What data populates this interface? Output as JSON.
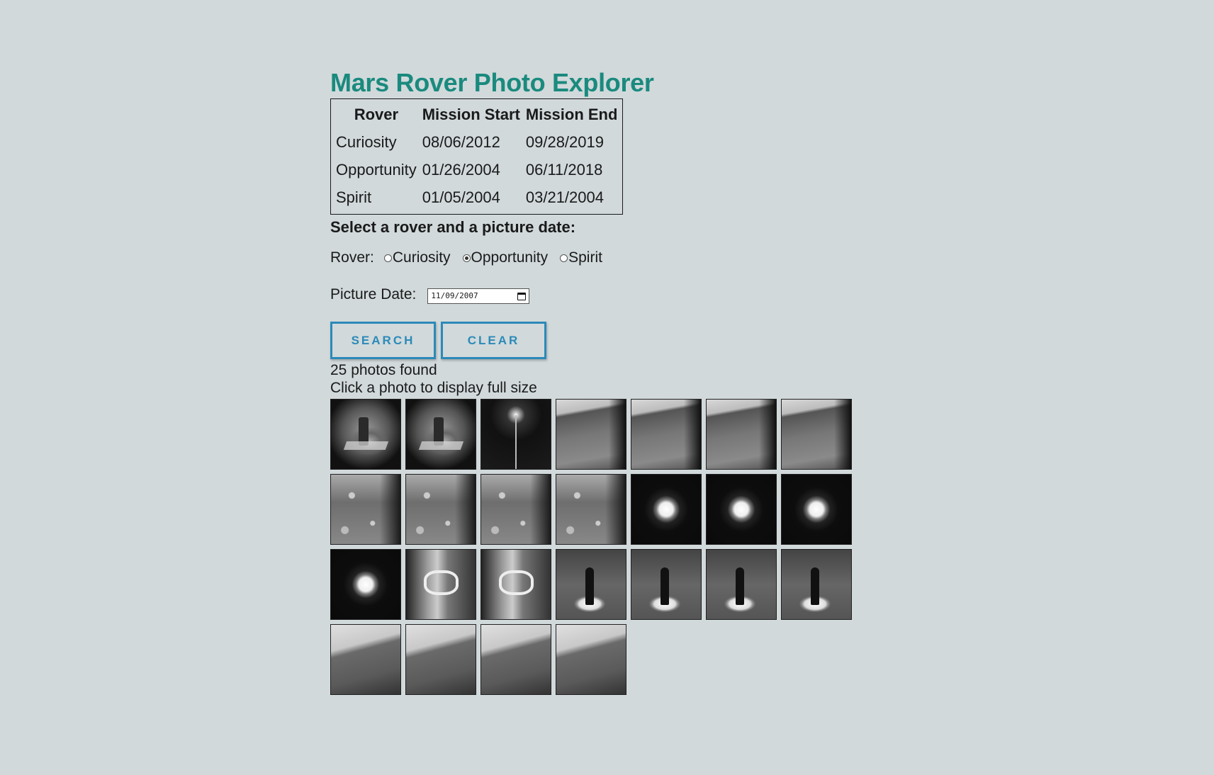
{
  "page": {
    "title": "Mars Rover Photo Explorer"
  },
  "missions_table": {
    "headers": [
      "Rover",
      "Mission Start",
      "Mission End"
    ],
    "rows": [
      [
        "Curiosity",
        "08/06/2012",
        "09/28/2019"
      ],
      [
        "Opportunity",
        "01/26/2004",
        "06/11/2018"
      ],
      [
        "Spirit",
        "01/05/2004",
        "03/21/2004"
      ]
    ]
  },
  "form": {
    "prompt": "Select a rover and a picture date:",
    "rover_label": "Rover:",
    "rover_options": [
      {
        "label": "Curiosity",
        "checked": false
      },
      {
        "label": "Opportunity",
        "checked": true
      },
      {
        "label": "Spirit",
        "checked": false
      }
    ],
    "date_label": "Picture Date:",
    "date_value": "11/09/2007",
    "search_label": "SEARCH",
    "clear_label": "CLEAR"
  },
  "results": {
    "count_text": "25 photos found",
    "hint_text": "Click a photo to display full size",
    "thumbnails": [
      "fisheye",
      "fisheye",
      "mast",
      "horizon",
      "horizon",
      "horizon",
      "horizon",
      "ground",
      "ground",
      "ground",
      "ground",
      "sun",
      "sun",
      "sun",
      "sun",
      "tool",
      "tool",
      "dial",
      "dial",
      "dial",
      "dial",
      "hill",
      "hill",
      "hill",
      "hill"
    ]
  },
  "colors": {
    "background": "#d1d9db",
    "title": "#1a8a7e",
    "button_accent": "#2b8ab8"
  }
}
